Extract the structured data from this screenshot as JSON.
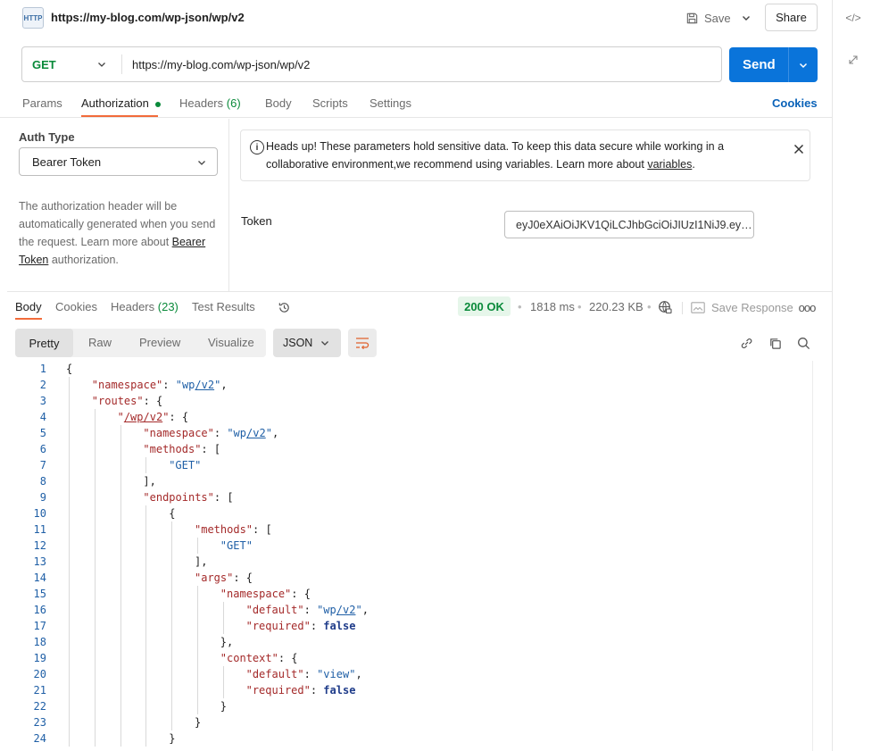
{
  "request": {
    "title": "https://my-blog.com/wp-json/wp/v2",
    "http_badge": "HTTP",
    "save_label": "Save",
    "share_label": "Share",
    "method": "GET",
    "url": "https://my-blog.com/wp-json/wp/v2",
    "send_label": "Send"
  },
  "req_tabs": {
    "params": "Params",
    "authorization": "Authorization",
    "headers": "Headers",
    "headers_count": "(6)",
    "body": "Body",
    "scripts": "Scripts",
    "settings": "Settings",
    "cookies": "Cookies"
  },
  "auth": {
    "type_label": "Auth Type",
    "type_value": "Bearer Token",
    "desc_prefix": "The authorization header will be automatically generated when you send the request. Learn more about ",
    "desc_link": "Bearer Token",
    "desc_suffix": " authorization.",
    "alert_text": "Heads up! These parameters hold sensitive data. To keep this data secure while working in a collaborative environment,we recommend using variables. Learn more about ",
    "alert_link": "variables",
    "alert_end": ".",
    "token_label": "Token",
    "token_value": "eyJ0eXAiOiJKV1QiLCJhbGciOiJIUzI1NiJ9.ey…"
  },
  "response": {
    "tabs": {
      "body": "Body",
      "cookies": "Cookies",
      "headers": "Headers",
      "headers_count": "(23)",
      "test_results": "Test Results"
    },
    "status": "200 OK",
    "time": "1818 ms",
    "size": "220.23 KB",
    "save_response": "Save Response",
    "view_modes": [
      "Pretty",
      "Raw",
      "Preview",
      "Visualize"
    ],
    "format": "JSON"
  },
  "code_lines": [
    {
      "n": "1",
      "indent": 0,
      "parts": [
        [
          "punc",
          "{"
        ]
      ]
    },
    {
      "n": "2",
      "indent": 1,
      "parts": [
        [
          "key",
          "\"namespace\""
        ],
        [
          "punc",
          ": "
        ],
        [
          "str",
          "\"wp/v2\""
        ],
        [
          "punc",
          ","
        ]
      ]
    },
    {
      "n": "3",
      "indent": 1,
      "parts": [
        [
          "key",
          "\"routes\""
        ],
        [
          "punc",
          ": {"
        ]
      ]
    },
    {
      "n": "4",
      "indent": 2,
      "parts": [
        [
          "key",
          "\"/wp/v2\""
        ],
        [
          "punc",
          ": {"
        ]
      ]
    },
    {
      "n": "5",
      "indent": 3,
      "parts": [
        [
          "key",
          "\"namespace\""
        ],
        [
          "punc",
          ": "
        ],
        [
          "str",
          "\"wp/v2\""
        ],
        [
          "punc",
          ","
        ]
      ]
    },
    {
      "n": "6",
      "indent": 3,
      "parts": [
        [
          "key",
          "\"methods\""
        ],
        [
          "punc",
          ": ["
        ]
      ]
    },
    {
      "n": "7",
      "indent": 4,
      "parts": [
        [
          "str",
          "\"GET\""
        ]
      ]
    },
    {
      "n": "8",
      "indent": 3,
      "parts": [
        [
          "punc",
          "],"
        ]
      ]
    },
    {
      "n": "9",
      "indent": 3,
      "parts": [
        [
          "key",
          "\"endpoints\""
        ],
        [
          "punc",
          ": ["
        ]
      ]
    },
    {
      "n": "10",
      "indent": 4,
      "parts": [
        [
          "punc",
          "{"
        ]
      ]
    },
    {
      "n": "11",
      "indent": 5,
      "parts": [
        [
          "key",
          "\"methods\""
        ],
        [
          "punc",
          ": ["
        ]
      ]
    },
    {
      "n": "12",
      "indent": 6,
      "parts": [
        [
          "str",
          "\"GET\""
        ]
      ]
    },
    {
      "n": "13",
      "indent": 5,
      "parts": [
        [
          "punc",
          "],"
        ]
      ]
    },
    {
      "n": "14",
      "indent": 5,
      "parts": [
        [
          "key",
          "\"args\""
        ],
        [
          "punc",
          ": {"
        ]
      ]
    },
    {
      "n": "15",
      "indent": 6,
      "parts": [
        [
          "key",
          "\"namespace\""
        ],
        [
          "punc",
          ": {"
        ]
      ]
    },
    {
      "n": "16",
      "indent": 7,
      "parts": [
        [
          "key",
          "\"default\""
        ],
        [
          "punc",
          ": "
        ],
        [
          "str",
          "\"wp/v2\""
        ],
        [
          "punc",
          ","
        ]
      ]
    },
    {
      "n": "17",
      "indent": 7,
      "parts": [
        [
          "key",
          "\"required\""
        ],
        [
          "punc",
          ": "
        ],
        [
          "kw",
          "false"
        ]
      ]
    },
    {
      "n": "18",
      "indent": 6,
      "parts": [
        [
          "punc",
          "},"
        ]
      ]
    },
    {
      "n": "19",
      "indent": 6,
      "parts": [
        [
          "key",
          "\"context\""
        ],
        [
          "punc",
          ": {"
        ]
      ]
    },
    {
      "n": "20",
      "indent": 7,
      "parts": [
        [
          "key",
          "\"default\""
        ],
        [
          "punc",
          ": "
        ],
        [
          "str",
          "\"view\""
        ],
        [
          "punc",
          ","
        ]
      ]
    },
    {
      "n": "21",
      "indent": 7,
      "parts": [
        [
          "key",
          "\"required\""
        ],
        [
          "punc",
          ": "
        ],
        [
          "kw",
          "false"
        ]
      ]
    },
    {
      "n": "22",
      "indent": 6,
      "parts": [
        [
          "punc",
          "}"
        ]
      ]
    },
    {
      "n": "23",
      "indent": 5,
      "parts": [
        [
          "punc",
          "}"
        ]
      ]
    },
    {
      "n": "24",
      "indent": 4,
      "parts": [
        [
          "punc",
          "}"
        ]
      ]
    }
  ],
  "colors": {
    "accent": "#0a74da",
    "tab_underline": "#f26b3a",
    "status_ok": "#0a8a3a",
    "status_bg": "#e6f6ea"
  }
}
